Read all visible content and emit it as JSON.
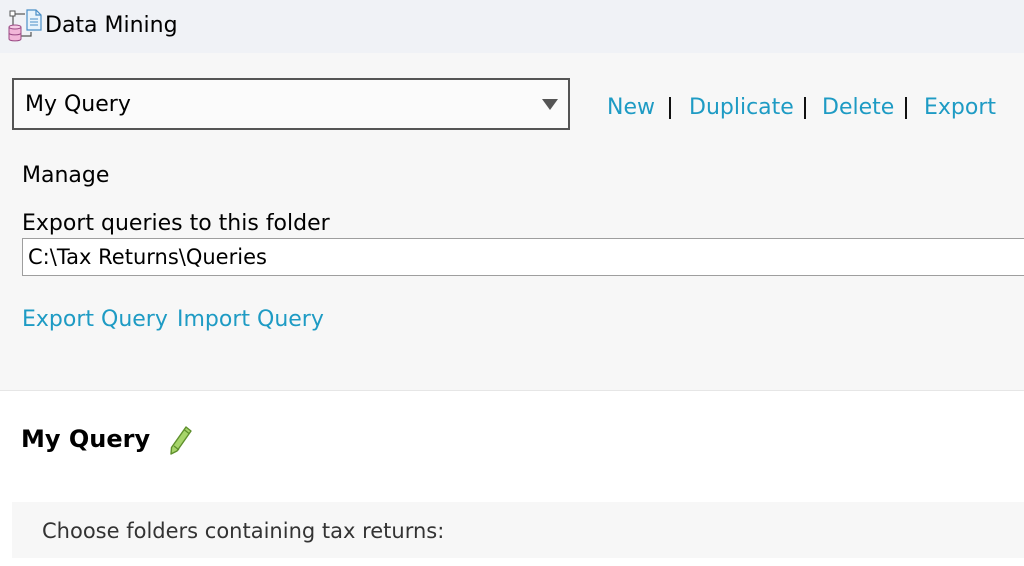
{
  "window": {
    "title": "Data Mining",
    "icon": "database-document-icon"
  },
  "query_selector": {
    "selected": "My Query"
  },
  "actions": {
    "new": "New",
    "duplicate": "Duplicate",
    "delete": "Delete",
    "export": "Export"
  },
  "manage": {
    "heading": "Manage",
    "folder_label": "Export queries to this folder",
    "folder_value": "C:\\Tax Returns\\Queries",
    "export_query": "Export Query",
    "import_query": "Import Query"
  },
  "query_detail": {
    "title": "My Query",
    "edit_icon": "pencil-icon",
    "folders_prompt": "Choose folders containing tax returns:"
  },
  "colors": {
    "link": "#1e9bc4",
    "titlebar_bg": "#f0f2f6",
    "panel_bg": "#f7f7f7",
    "pencil": "#8cc04b"
  }
}
